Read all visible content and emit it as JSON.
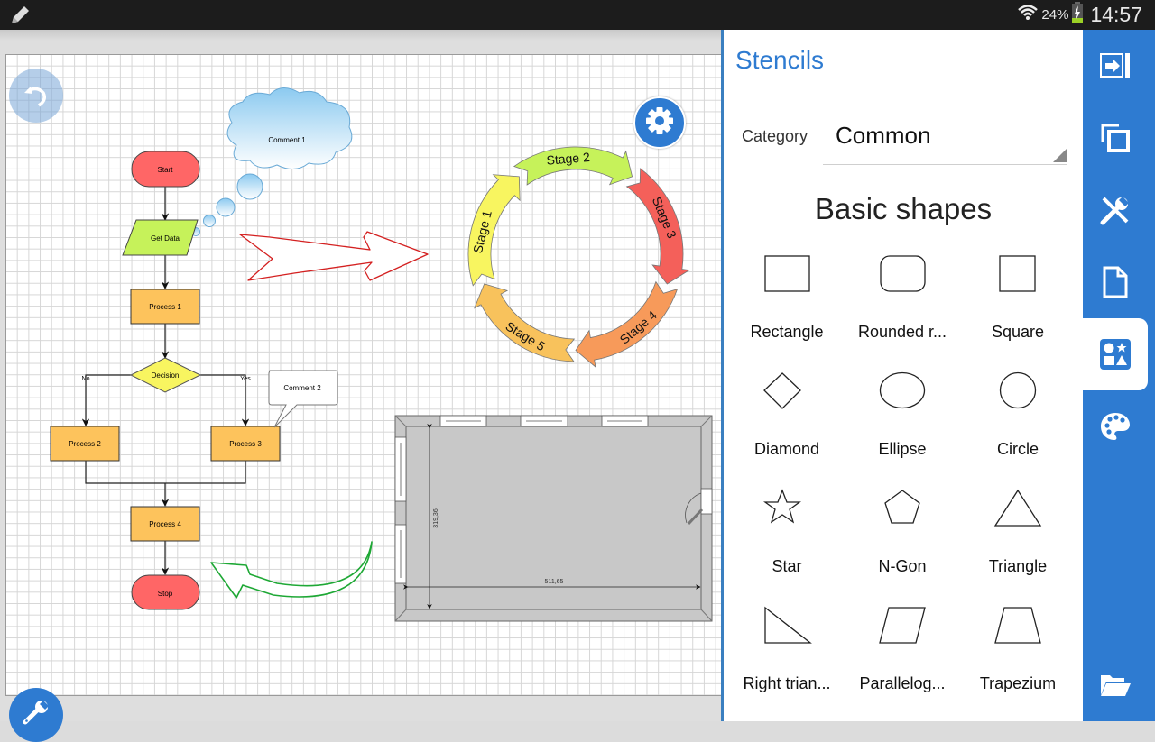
{
  "status_bar": {
    "app_icon": "pencil-icon",
    "battery_percent": "24%",
    "time": "14:57",
    "icons": [
      "wifi-icon",
      "battery-charging-icon"
    ]
  },
  "canvas": {
    "buttons": {
      "undo": "undo-icon",
      "settings": "gear-icon",
      "tools": "wrench-icon"
    },
    "flowchart": {
      "start": "Start",
      "get_data": "Get Data",
      "process1": "Process 1",
      "decision": "Decision",
      "no": "No",
      "yes": "Yes",
      "process2": "Process 2",
      "process3": "Process 3",
      "process4": "Process 4",
      "stop": "Stop",
      "comment1": "Comment 1",
      "comment2": "Comment 2"
    },
    "cycle": {
      "stages": [
        {
          "label": "Stage 1",
          "color": "#f8f560"
        },
        {
          "label": "Stage 2",
          "color": "#c6f25a"
        },
        {
          "label": "Stage 3",
          "color": "#f4605a"
        },
        {
          "label": "Stage 4",
          "color": "#f79a5a"
        },
        {
          "label": "Stage 5",
          "color": "#f8c25c"
        }
      ]
    },
    "floorplan": {
      "width_label": "511,65",
      "height_label": "319,36"
    },
    "colors": {
      "terminal": "#ff6666",
      "io": "#c6f25a",
      "process": "#fdc35c",
      "decision": "#f8f560",
      "accent": "#2e7bd1"
    }
  },
  "stencils": {
    "title": "Stencils",
    "category_label": "Category",
    "category_value": "Common",
    "section_title": "Basic shapes",
    "shapes": [
      {
        "label": "Rectangle",
        "icon": "rectangle-shape-icon"
      },
      {
        "label": "Rounded r...",
        "icon": "rounded-rectangle-shape-icon"
      },
      {
        "label": "Square",
        "icon": "square-shape-icon"
      },
      {
        "label": "Diamond",
        "icon": "diamond-shape-icon"
      },
      {
        "label": "Ellipse",
        "icon": "ellipse-shape-icon"
      },
      {
        "label": "Circle",
        "icon": "circle-shape-icon"
      },
      {
        "label": "Star",
        "icon": "star-shape-icon"
      },
      {
        "label": "N-Gon",
        "icon": "pentagon-shape-icon"
      },
      {
        "label": "Triangle",
        "icon": "triangle-shape-icon"
      },
      {
        "label": "Right trian...",
        "icon": "right-triangle-shape-icon"
      },
      {
        "label": "Parallelog...",
        "icon": "parallelogram-shape-icon"
      },
      {
        "label": "Trapezium",
        "icon": "trapezium-shape-icon"
      }
    ]
  },
  "rail": {
    "items": [
      {
        "icon": "exit-panel-icon",
        "active": false
      },
      {
        "icon": "copy-icon",
        "active": false
      },
      {
        "icon": "tools-icon",
        "active": false
      },
      {
        "icon": "page-icon",
        "active": false
      },
      {
        "icon": "shapes-icon",
        "active": true
      },
      {
        "icon": "palette-icon",
        "active": false
      },
      {
        "icon": "folder-open-icon",
        "active": false
      }
    ]
  }
}
